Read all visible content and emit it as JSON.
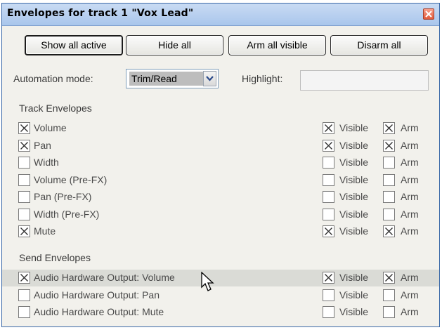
{
  "window": {
    "title": "Envelopes for track 1 \"Vox Lead\"",
    "close_icon": "close-icon"
  },
  "toolbar": {
    "show_all_active": "Show all active",
    "hide_all": "Hide all",
    "arm_all_visible": "Arm all visible",
    "disarm_all": "Disarm all"
  },
  "automation": {
    "label": "Automation mode:",
    "value": "Trim/Read",
    "highlight_label": "Highlight:",
    "highlight_value": ""
  },
  "track_envelopes": {
    "header": "Track Envelopes",
    "items": [
      {
        "label": "Volume",
        "enabled": true,
        "visible": true,
        "arm": true
      },
      {
        "label": "Pan",
        "enabled": true,
        "visible": true,
        "arm": true
      },
      {
        "label": "Width",
        "enabled": false,
        "visible": false,
        "arm": false
      },
      {
        "label": "Volume (Pre-FX)",
        "enabled": false,
        "visible": false,
        "arm": false
      },
      {
        "label": "Pan (Pre-FX)",
        "enabled": false,
        "visible": false,
        "arm": false
      },
      {
        "label": "Width (Pre-FX)",
        "enabled": false,
        "visible": false,
        "arm": false
      },
      {
        "label": "Mute",
        "enabled": true,
        "visible": true,
        "arm": true
      }
    ]
  },
  "send_envelopes": {
    "header": "Send Envelopes",
    "items": [
      {
        "label": "Audio Hardware Output: Volume",
        "enabled": true,
        "visible": true,
        "arm": true
      },
      {
        "label": "Audio Hardware Output: Pan",
        "enabled": false,
        "visible": false,
        "arm": false
      },
      {
        "label": "Audio Hardware Output: Mute",
        "enabled": false,
        "visible": false,
        "arm": false
      }
    ]
  },
  "column_labels": {
    "visible": "Visible",
    "arm": "Arm"
  }
}
